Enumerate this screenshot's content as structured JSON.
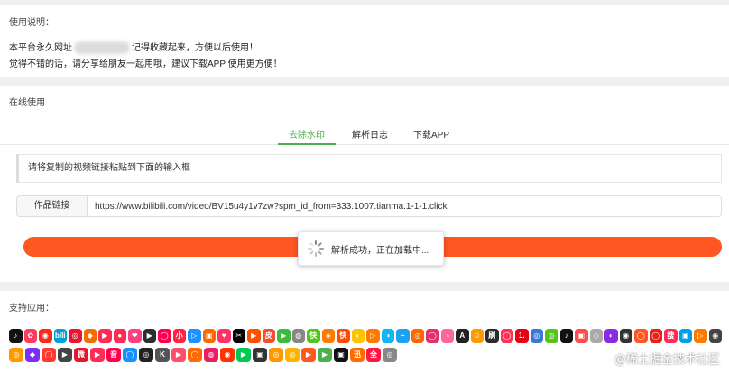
{
  "usage": {
    "title": "使用说明：",
    "line1_prefix": "本平台永久网址",
    "line1_suffix": "记得收藏起来，方便以后使用！",
    "line2": "觉得不错的话，请分享给朋友一起用哦，建议下载APP 使用更方便！"
  },
  "online": {
    "title": "在线使用",
    "tabs": [
      "去除水印",
      "解析日志",
      "下载APP"
    ],
    "active_tab": "去除水印",
    "hint": "请将复制的视频链接粘贴到下面的输入框",
    "input_label": "作品链接",
    "input_value": "https://www.bilibili.com/video/BV15u4y1v7zw?spm_id_from=333.1007.tianma.1-1-1.click",
    "toast_text": "解析成功，正在加载中..."
  },
  "apps": {
    "title": "支持应用：",
    "row1": [
      {
        "label": "♪",
        "color": "#111111"
      },
      {
        "label": "✿",
        "color": "#ff3b5c"
      },
      {
        "label": "◉",
        "color": "#fa2c19"
      },
      {
        "label": "bili",
        "color": "#00a1d6"
      },
      {
        "label": "◎",
        "color": "#e6162d"
      },
      {
        "label": "◆",
        "color": "#f56c00"
      },
      {
        "label": "▶",
        "color": "#ff2d55"
      },
      {
        "label": "●",
        "color": "#fe2c55"
      },
      {
        "label": "❤",
        "color": "#ff4081"
      },
      {
        "label": "▶",
        "color": "#2d2d2d"
      },
      {
        "label": "◯",
        "color": "#ff0050"
      },
      {
        "label": "小红",
        "color": "#ff2442"
      },
      {
        "label": "▷",
        "color": "#1e90ff"
      },
      {
        "label": "▣",
        "color": "#ff6a00"
      },
      {
        "label": "♥",
        "color": "#ff3366"
      },
      {
        "label": "✂",
        "color": "#000000"
      },
      {
        "label": "▶",
        "color": "#ff5000"
      },
      {
        "label": "皮",
        "color": "#f04e30"
      },
      {
        "label": "▶",
        "color": "#3dbb3d"
      },
      {
        "label": "◍",
        "color": "#888888"
      },
      {
        "label": "快",
        "color": "#52c41a"
      },
      {
        "label": "◈",
        "color": "#ff7a00"
      },
      {
        "label": "快",
        "color": "#ff4906"
      },
      {
        "label": "◐",
        "color": "#ffc300"
      },
      {
        "label": "▷",
        "color": "#ff7a00"
      },
      {
        "label": "◑",
        "color": "#12b7f5"
      },
      {
        "label": "~",
        "color": "#1da1f2"
      },
      {
        "label": "◎",
        "color": "#ff6600"
      },
      {
        "label": "◯",
        "color": "#e1306c"
      },
      {
        "label": "◑",
        "color": "#ff6699"
      },
      {
        "label": "A",
        "color": "#222222"
      },
      {
        "label": "☺",
        "color": "#ff9900"
      },
      {
        "label": "刷",
        "color": "#2b2b2b"
      },
      {
        "label": "◯",
        "color": "#ff3355"
      },
      {
        "label": "1.",
        "color": "#e60012"
      },
      {
        "label": "◎",
        "color": "#3c78d8"
      },
      {
        "label": "◎",
        "color": "#52c41a"
      },
      {
        "label": "♪",
        "color": "#111111"
      },
      {
        "label": "▣",
        "color": "#ff4d4f"
      },
      {
        "label": "◇",
        "color": "#aaaaaa"
      },
      {
        "label": "◐",
        "color": "#8a2be2"
      },
      {
        "label": "◉",
        "color": "#333333"
      },
      {
        "label": "◯",
        "color": "#ff5722"
      },
      {
        "label": "◯",
        "color": "#e62117"
      },
      {
        "label": "搜",
        "color": "#ff2d55"
      },
      {
        "label": "▣",
        "color": "#00a0e9"
      },
      {
        "label": "▷",
        "color": "#ff7a00"
      },
      {
        "label": "◉",
        "color": "#444444"
      }
    ],
    "row2": [
      {
        "label": "◎",
        "color": "#ff9900"
      },
      {
        "label": "◆",
        "color": "#7b2ff7"
      },
      {
        "label": "◯",
        "color": "#ff3b30"
      },
      {
        "label": "▶",
        "color": "#444444"
      },
      {
        "label": "微",
        "color": "#e6162d"
      },
      {
        "label": "▶",
        "color": "#ff2d55"
      },
      {
        "label": "音",
        "color": "#ff0050"
      },
      {
        "label": "◯",
        "color": "#1890ff"
      },
      {
        "label": "◎",
        "color": "#222222"
      },
      {
        "label": "K",
        "color": "#555555"
      },
      {
        "label": "▶",
        "color": "#ff4d6a"
      },
      {
        "label": "◯",
        "color": "#ff6b00"
      },
      {
        "label": "◍",
        "color": "#e91e63"
      },
      {
        "label": "◉",
        "color": "#ff3300"
      },
      {
        "label": "▶",
        "color": "#00c853"
      },
      {
        "label": "▣",
        "color": "#333333"
      },
      {
        "label": "◎",
        "color": "#ff9800"
      },
      {
        "label": "◎",
        "color": "#ffb300"
      },
      {
        "label": "▶",
        "color": "#ff5722"
      },
      {
        "label": "▶",
        "color": "#4caf50"
      },
      {
        "label": "▣",
        "color": "#111111"
      },
      {
        "label": "迅",
        "color": "#ff6d00"
      },
      {
        "label": "全",
        "color": "#ff1744"
      },
      {
        "label": "◎",
        "color": "#888888"
      }
    ],
    "watermark": "@稀土掘金技术社区"
  }
}
